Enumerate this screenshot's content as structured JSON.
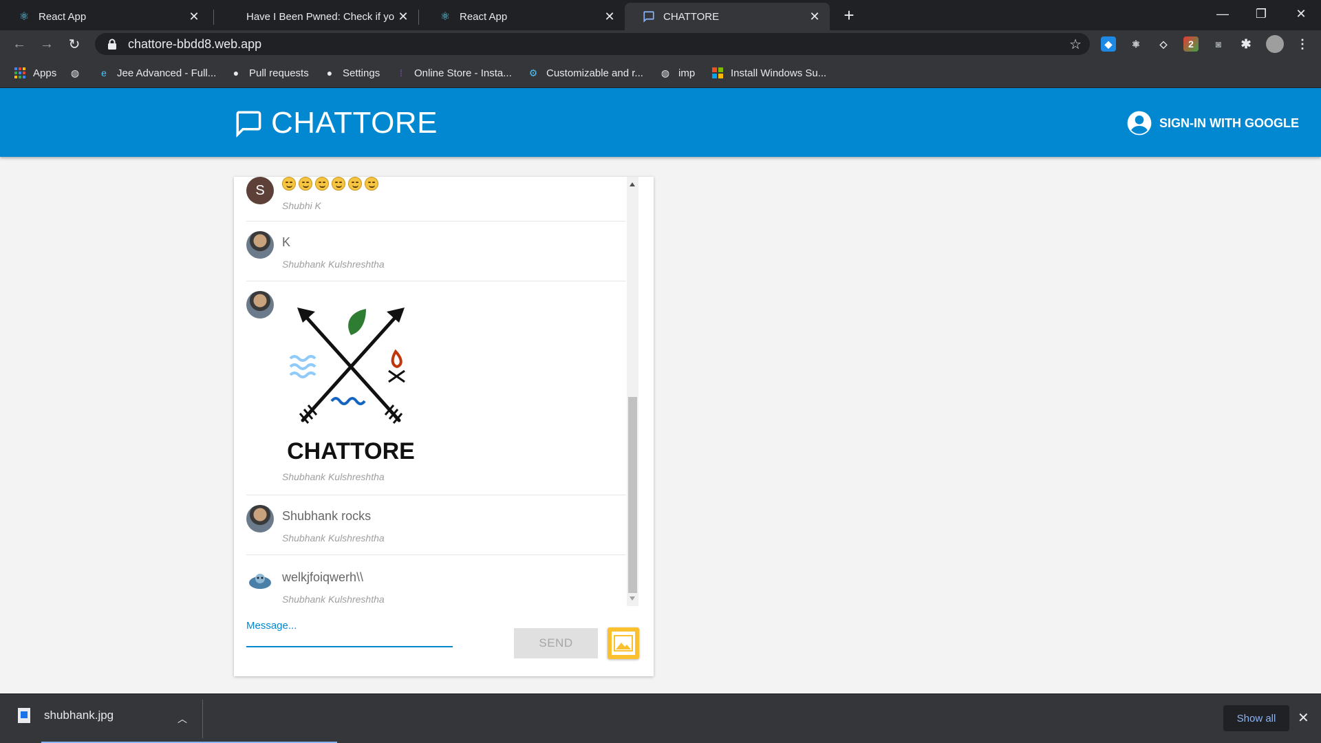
{
  "browser": {
    "tabs": [
      {
        "title": "React App",
        "icon": "react-icon"
      },
      {
        "title": "Have I Been Pwned: Check if your",
        "icon": "none"
      },
      {
        "title": "React App",
        "icon": "react-icon"
      },
      {
        "title": "CHATTORE",
        "icon": "chat-icon"
      }
    ],
    "active_tab": 3,
    "url": "chattore-bbdd8.web.app",
    "bookmarks": [
      {
        "label": "Apps",
        "icon": "apps-grid-icon"
      },
      {
        "label": "",
        "icon": "globe-icon"
      },
      {
        "label": "Jee Advanced - Full...",
        "icon": "edge-icon"
      },
      {
        "label": "Pull requests",
        "icon": "github-icon"
      },
      {
        "label": "Settings",
        "icon": "github-icon"
      },
      {
        "label": "Online Store - Insta...",
        "icon": "instamojo-icon"
      },
      {
        "label": "Customizable and r...",
        "icon": "gear-icon"
      },
      {
        "label": "imp",
        "icon": "globe-icon"
      },
      {
        "label": "Install Windows Su...",
        "icon": "windows-icon"
      }
    ]
  },
  "app": {
    "title": "CHATTORE",
    "signin_label": "SIGN-IN WITH GOOGLE",
    "brand_color": "#0288d1"
  },
  "messages": [
    {
      "avatar": "letter",
      "avatar_letter": "S",
      "text": "",
      "emojis": 6,
      "author": "Shubhi K"
    },
    {
      "avatar": "photo",
      "text": "K",
      "author": "Shubhank Kulshreshtha"
    },
    {
      "avatar": "photo",
      "image_caption": "CHATTORE",
      "author": "Shubhank Kulshreshtha"
    },
    {
      "avatar": "photo",
      "text": "Shubhank rocks",
      "author": "Shubhank Kulshreshtha"
    },
    {
      "avatar": "cartoon",
      "text": "welkjfoiqwerh\\\\",
      "author": "Shubhank Kulshreshtha"
    }
  ],
  "composer": {
    "label": "Message...",
    "value": "",
    "send_label": "SEND"
  },
  "downloads": {
    "file": "shubhank.jpg",
    "show_all": "Show all"
  }
}
